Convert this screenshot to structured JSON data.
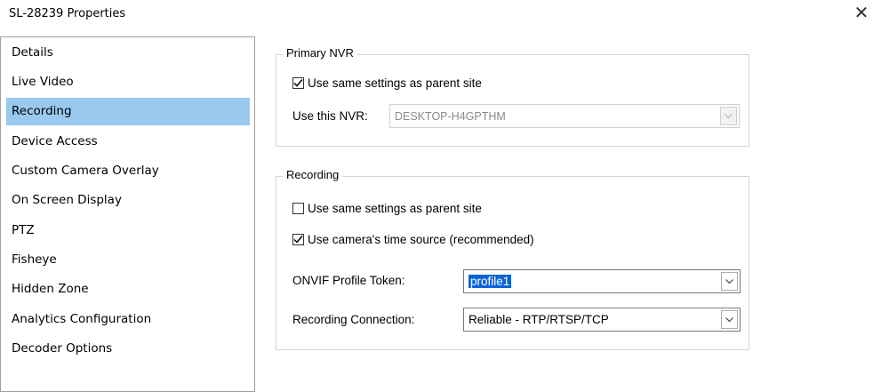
{
  "window": {
    "title": "SL-28239 Properties",
    "close_glyph": "✕"
  },
  "nav": {
    "items": [
      {
        "label": "Details"
      },
      {
        "label": "Live Video"
      },
      {
        "label": "Recording",
        "selected": true
      },
      {
        "label": "Device Access"
      },
      {
        "label": "Custom Camera Overlay"
      },
      {
        "label": "On Screen Display"
      },
      {
        "label": "PTZ"
      },
      {
        "label": "Fisheye"
      },
      {
        "label": "Hidden Zone"
      },
      {
        "label": "Analytics Configuration"
      },
      {
        "label": "Decoder Options"
      }
    ],
    "selected_color": "#99c9ef"
  },
  "primary_nvr": {
    "legend": "Primary NVR",
    "use_parent_label": "Use same settings as parent site",
    "use_parent_checked": true,
    "nvr_label": "Use this NVR:",
    "nvr_value": "DESKTOP-H4GPTHM",
    "nvr_disabled": true
  },
  "recording": {
    "legend": "Recording",
    "use_parent_label": "Use same settings as parent site",
    "use_parent_checked": false,
    "time_source_label": "Use camera's time source (recommended)",
    "time_source_checked": true,
    "profile_label": "ONVIF Profile Token:",
    "profile_value": "profile1",
    "connection_label": "Recording Connection:",
    "connection_value": "Reliable - RTP/RTSP/TCP"
  },
  "icons": {
    "checkmark": "checkmark-icon",
    "dropdown": "chevron-down-icon",
    "close": "close-icon"
  },
  "colors": {
    "selection": "#99c9ef",
    "text_highlight": "#0a64d8",
    "group_border": "#d5d5d5"
  }
}
